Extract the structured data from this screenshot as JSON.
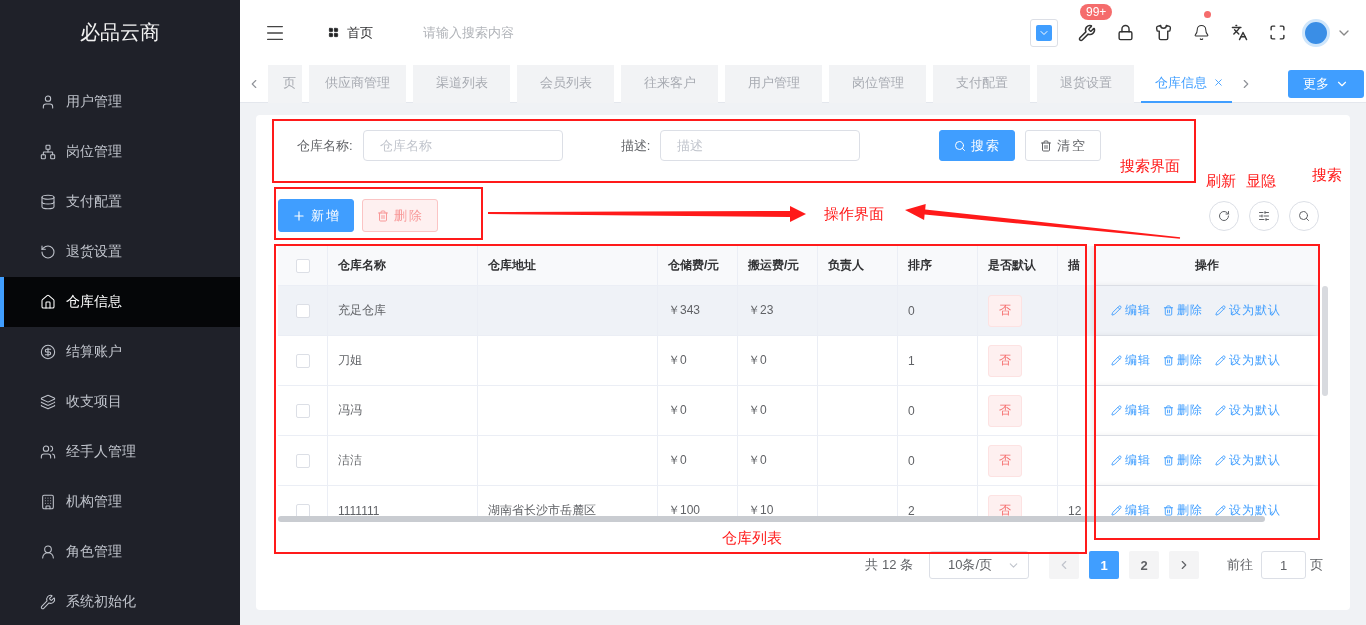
{
  "sidebar": {
    "logo": "必品云商",
    "items": [
      {
        "label": "用户管理",
        "selected": false
      },
      {
        "label": "岗位管理",
        "selected": false
      },
      {
        "label": "支付配置",
        "selected": false
      },
      {
        "label": "退货设置",
        "selected": false
      },
      {
        "label": "仓库信息",
        "selected": true
      },
      {
        "label": "结算账户",
        "selected": false
      },
      {
        "label": "收支项目",
        "selected": false
      },
      {
        "label": "经手人管理",
        "selected": false
      },
      {
        "label": "机构管理",
        "selected": false
      },
      {
        "label": "角色管理",
        "selected": false
      },
      {
        "label": "系统初始化",
        "selected": false
      }
    ]
  },
  "header": {
    "breadcrumb": "首页",
    "search": {
      "placeholder": "请输入搜索内容"
    },
    "badge": "99+",
    "bell_unread": true
  },
  "tabs": {
    "items": [
      {
        "label": "页",
        "selected": false
      },
      {
        "label": "供应商管理",
        "selected": false
      },
      {
        "label": "渠道列表",
        "selected": false
      },
      {
        "label": "会员列表",
        "selected": false
      },
      {
        "label": "往来客户",
        "selected": false
      },
      {
        "label": "用户管理",
        "selected": false
      },
      {
        "label": "岗位管理",
        "selected": false
      },
      {
        "label": "支付配置",
        "selected": false
      },
      {
        "label": "退货设置",
        "selected": false
      },
      {
        "label": "仓库信息",
        "selected": true
      }
    ],
    "more": "更多"
  },
  "search_form": {
    "fields": [
      {
        "label": "仓库名称:",
        "placeholder": "仓库名称"
      },
      {
        "label": "描述:",
        "placeholder": "描述"
      }
    ],
    "buttons": [
      "搜索",
      "清空"
    ]
  },
  "toolbar": {
    "buttons": [
      "新增",
      "删除"
    ]
  },
  "table": {
    "header_checked": false,
    "columns": [
      "仓库名称",
      "仓库地址",
      "仓储费/元",
      "搬运费/元",
      "负责人",
      "排序",
      "是否默认",
      "描"
    ],
    "action_column": "操作",
    "rows": [
      {
        "checked": false,
        "highlighted": true,
        "cells": [
          "充足仓库",
          null,
          "￥343",
          "￥23",
          null,
          "0",
          "否",
          null
        ],
        "actions": [
          "编辑",
          "删除",
          "设为默认"
        ]
      },
      {
        "checked": false,
        "highlighted": false,
        "cells": [
          "刀姐",
          null,
          "￥0",
          "￥0",
          null,
          "1",
          "否",
          null
        ],
        "actions": [
          "编辑",
          "删除",
          "设为默认"
        ]
      },
      {
        "checked": false,
        "highlighted": false,
        "cells": [
          "冯冯",
          null,
          "￥0",
          "￥0",
          null,
          "0",
          "否",
          null
        ],
        "actions": [
          "编辑",
          "删除",
          "设为默认"
        ]
      },
      {
        "checked": false,
        "highlighted": false,
        "cells": [
          "洁洁",
          null,
          "￥0",
          "￥0",
          null,
          "0",
          "否",
          null
        ],
        "actions": [
          "编辑",
          "删除",
          "设为默认"
        ]
      },
      {
        "checked": false,
        "highlighted": false,
        "cells": [
          "1111111",
          "湖南省长沙市岳麓区",
          "￥100",
          "￥10",
          null,
          "2",
          "否",
          "12"
        ],
        "actions": [
          "编辑",
          "删除",
          "设为默认"
        ]
      }
    ]
  },
  "pagination": {
    "total": "共 12 条",
    "page_size": "10条/页",
    "pages": [
      {
        "label": "1",
        "selected": true
      },
      {
        "label": "2",
        "selected": false
      }
    ],
    "goto_label": "前往",
    "goto_value": "1",
    "goto_suffix": "页"
  },
  "annotations": {
    "labels": [
      "搜索界面",
      "刷新",
      "显隐",
      "搜索",
      "操作界面",
      "仓库列表"
    ]
  }
}
